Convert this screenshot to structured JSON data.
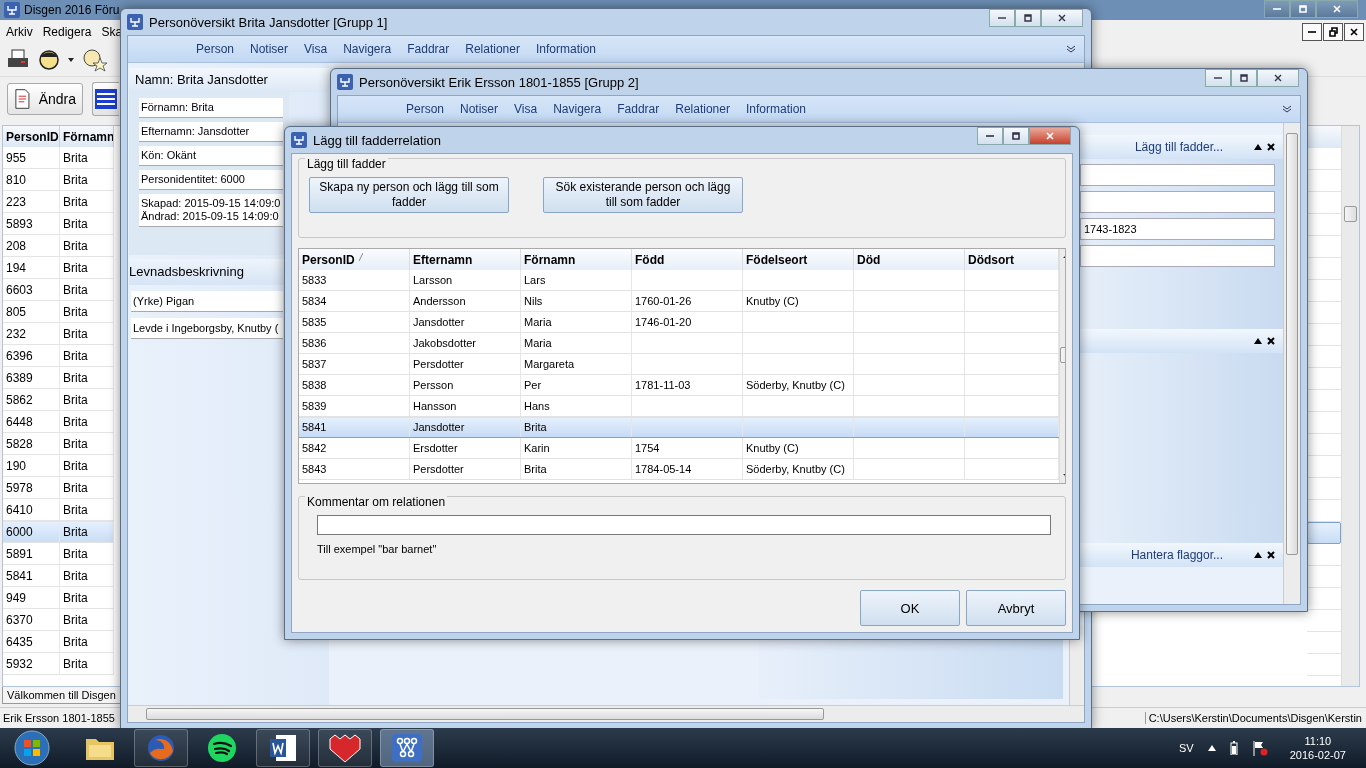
{
  "main_window": {
    "title": "Disgen 2016 Föru",
    "menu": [
      "Arkiv",
      "Redigera",
      "Ska"
    ],
    "edit_button": "Ändra",
    "list": {
      "columns": [
        "PersonID",
        "Förnamn"
      ],
      "rows": [
        {
          "id": "955",
          "first_name": "Brita",
          "selected": false
        },
        {
          "id": "810",
          "first_name": "Brita",
          "selected": false
        },
        {
          "id": "223",
          "first_name": "Brita",
          "selected": false
        },
        {
          "id": "5893",
          "first_name": "Brita",
          "selected": false
        },
        {
          "id": "208",
          "first_name": "Brita",
          "selected": false
        },
        {
          "id": "194",
          "first_name": "Brita",
          "selected": false
        },
        {
          "id": "6603",
          "first_name": "Brita",
          "selected": false
        },
        {
          "id": "805",
          "first_name": "Brita",
          "selected": false
        },
        {
          "id": "232",
          "first_name": "Brita",
          "selected": false
        },
        {
          "id": "6396",
          "first_name": "Brita",
          "selected": false
        },
        {
          "id": "6389",
          "first_name": "Brita",
          "selected": false
        },
        {
          "id": "5862",
          "first_name": "Brita",
          "selected": false
        },
        {
          "id": "6448",
          "first_name": "Brita",
          "selected": false
        },
        {
          "id": "5828",
          "first_name": "Brita",
          "selected": false
        },
        {
          "id": "190",
          "first_name": "Brita",
          "selected": false
        },
        {
          "id": "5978",
          "first_name": "Brita",
          "selected": false
        },
        {
          "id": "6410",
          "first_name": "Brita",
          "selected": false
        },
        {
          "id": "6000",
          "first_name": "Brita",
          "selected": true
        },
        {
          "id": "5891",
          "first_name": "Brita",
          "selected": false
        },
        {
          "id": "5841",
          "first_name": "Brita",
          "selected": false
        },
        {
          "id": "949",
          "first_name": "Brita",
          "selected": false
        },
        {
          "id": "6370",
          "first_name": "Brita",
          "selected": false
        },
        {
          "id": "6435",
          "first_name": "Brita",
          "selected": false
        },
        {
          "id": "5932",
          "first_name": "Brita",
          "selected": false
        }
      ]
    },
    "tab": "Välkommen till Disgen",
    "status_left": "Erik Ersson 1801-1855",
    "status_right": "C:\\Users\\Kerstin\\Documents\\Disgen\\Kerstin"
  },
  "person_window_1": {
    "title": "Personöversikt Brita Jansdotter  [Grupp 1]",
    "menu": [
      "Person",
      "Notiser",
      "Visa",
      "Navigera",
      "Faddrar",
      "Relationer",
      "Information"
    ],
    "name_header": "Namn: Brita Jansdotter",
    "fields": [
      "Förnamn: Brita",
      "Efternamn: Jansdotter",
      "Kön: Okänt",
      "Personidentitet: 6000",
      "Skapad: 2015-09-15 14:09:0\nÄndrad: 2015-09-15 14:09:0"
    ],
    "life_header": "Levnadsbeskrivning",
    "life_items": [
      "(Yrke) Pigan",
      "Levde i Ingeborgsby, Knutby ("
    ]
  },
  "person_window_2": {
    "title": "Personöversikt Erik Ersson 1801-1855 [Grupp 2]",
    "menu": [
      "Person",
      "Notiser",
      "Visa",
      "Navigera",
      "Faddrar",
      "Relationer",
      "Information"
    ],
    "godparent_panel": {
      "title": "Lägg till fadder...",
      "field_values": [
        "1743-1823"
      ]
    },
    "flags_panel": {
      "title": "Hantera flaggor..."
    }
  },
  "dialog": {
    "title": "Lägg till fadderrelation",
    "group_title": "Lägg till fadder",
    "create_button": "Skapa ny person och lägg till som fadder",
    "search_button": "Sök existerande person och lägg till som fadder",
    "table": {
      "columns": [
        "PersonID",
        "Efternamn",
        "Förnamn",
        "Född",
        "Födelseort",
        "Död",
        "Dödsort"
      ],
      "rows": [
        {
          "id": "5833",
          "surname": "Larsson",
          "first_name": "Lars",
          "selected": false
        },
        {
          "id": "5834",
          "surname": "Andersson",
          "first_name": "Nils",
          "born": "1760-01-26",
          "birthplace": "Knutby (C)",
          "selected": false
        },
        {
          "id": "5835",
          "surname": "Jansdotter",
          "first_name": "Maria",
          "born": "1746-01-20",
          "selected": false
        },
        {
          "id": "5836",
          "surname": "Jakobsdotter",
          "first_name": "Maria",
          "selected": false
        },
        {
          "id": "5837",
          "surname": "Persdotter",
          "first_name": "Margareta",
          "selected": false
        },
        {
          "id": "5838",
          "surname": "Persson",
          "first_name": "Per",
          "born": "1781-11-03",
          "birthplace": "Söderby, Knutby (C)",
          "selected": false
        },
        {
          "id": "5839",
          "surname": "Hansson",
          "first_name": "Hans",
          "selected": false
        },
        {
          "id": "5841",
          "surname": "Jansdotter",
          "first_name": "Brita",
          "selected": true
        },
        {
          "id": "5842",
          "surname": "Ersdotter",
          "first_name": "Karin",
          "born": "1754",
          "birthplace": "Knutby (C)",
          "selected": false
        },
        {
          "id": "5843",
          "surname": "Persdotter",
          "first_name": "Brita",
          "born": "1784-05-14",
          "birthplace": "Söderby, Knutby (C)",
          "selected": false
        }
      ]
    },
    "comment_group": "Kommentar om relationen",
    "comment_hint": "Till exempel \"bar barnet\"",
    "ok_button": "OK",
    "cancel_button": "Avbryt"
  },
  "taskbar": {
    "language": "SV",
    "time": "11:10",
    "date": "2016-02-07"
  }
}
